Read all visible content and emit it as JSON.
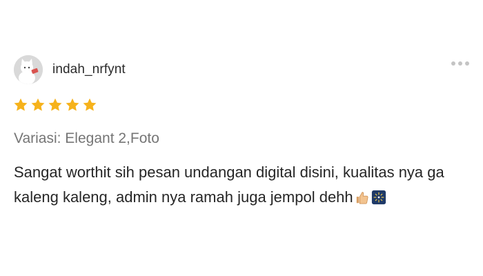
{
  "review": {
    "username": "indah_nrfynt",
    "rating": 5,
    "rating_max": 5,
    "star_color": "#F6B21B",
    "avatar": {
      "icon": "white-cat-avatar",
      "background": "#d9d9d9"
    },
    "variant": "Variasi: Elegant 2,Foto",
    "text": "Sangat worthit sih pesan undangan digital disini, kualitas nya ga kaleng kaleng, admin nya ramah juga jempol dehh",
    "emojis": [
      "thumbs-up-emoji",
      "fireworks-emoji"
    ]
  }
}
